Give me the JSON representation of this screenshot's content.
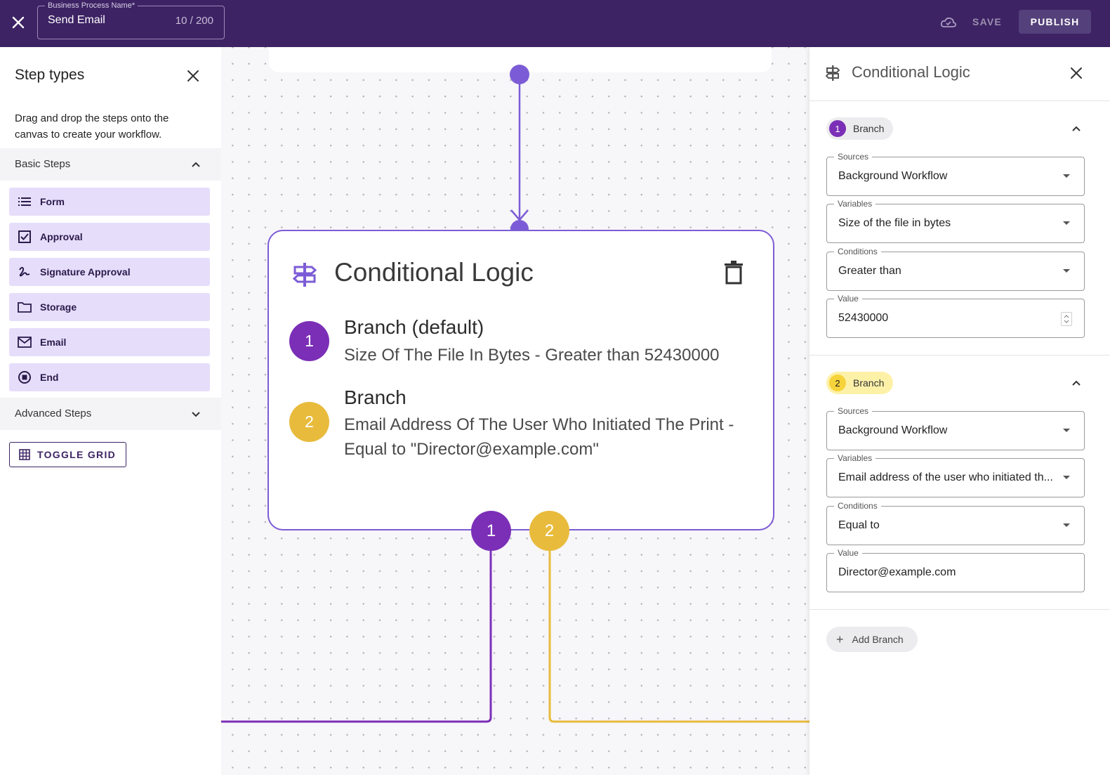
{
  "topbar": {
    "field_label": "Business Process Name*",
    "field_value": "Send Email",
    "char_count": "10 / 200",
    "save_label": "SAVE",
    "publish_label": "PUBLISH"
  },
  "left_panel": {
    "title": "Step types",
    "description": "Drag and drop the steps onto the canvas to create your workflow.",
    "basic_steps_label": "Basic Steps",
    "steps": [
      {
        "label": "Form",
        "icon": "list-icon"
      },
      {
        "label": "Approval",
        "icon": "checkbox-icon"
      },
      {
        "label": "Signature Approval",
        "icon": "signature-icon"
      },
      {
        "label": "Storage",
        "icon": "folder-icon"
      },
      {
        "label": "Email",
        "icon": "envelope-icon"
      },
      {
        "label": "End",
        "icon": "stop-circle-icon"
      }
    ],
    "advanced_steps_label": "Advanced Steps",
    "toggle_grid_label": "TOGGLE GRID"
  },
  "canvas": {
    "node_title": "Conditional Logic",
    "branches": [
      {
        "num": "1",
        "title": "Branch (default)",
        "desc": "Size Of The File In Bytes - Greater than 52430000",
        "color": "#7b2fb7"
      },
      {
        "num": "2",
        "title": "Branch",
        "desc": "Email Address Of The User Who Initiated The Print - Equal to \"Director@example.com\"",
        "color": "#e8bb3c"
      }
    ],
    "outputs": [
      "1",
      "2"
    ],
    "accent": "#7c5cd6"
  },
  "right_panel": {
    "title": "Conditional Logic",
    "branches": [
      {
        "num": "1",
        "label": "Branch",
        "sources_label": "Sources",
        "sources": "Background Workflow",
        "variables_label": "Variables",
        "variables": "Size of the file in bytes",
        "conditions_label": "Conditions",
        "conditions": "Greater than",
        "value_label": "Value",
        "value": "52430000"
      },
      {
        "num": "2",
        "label": "Branch",
        "sources_label": "Sources",
        "sources": "Background Workflow",
        "variables_label": "Variables",
        "variables": "Email address of the user who initiated th...",
        "conditions_label": "Conditions",
        "conditions": "Equal to",
        "value_label": "Value",
        "value": "Director@example.com"
      }
    ],
    "add_branch_label": "Add Branch"
  }
}
